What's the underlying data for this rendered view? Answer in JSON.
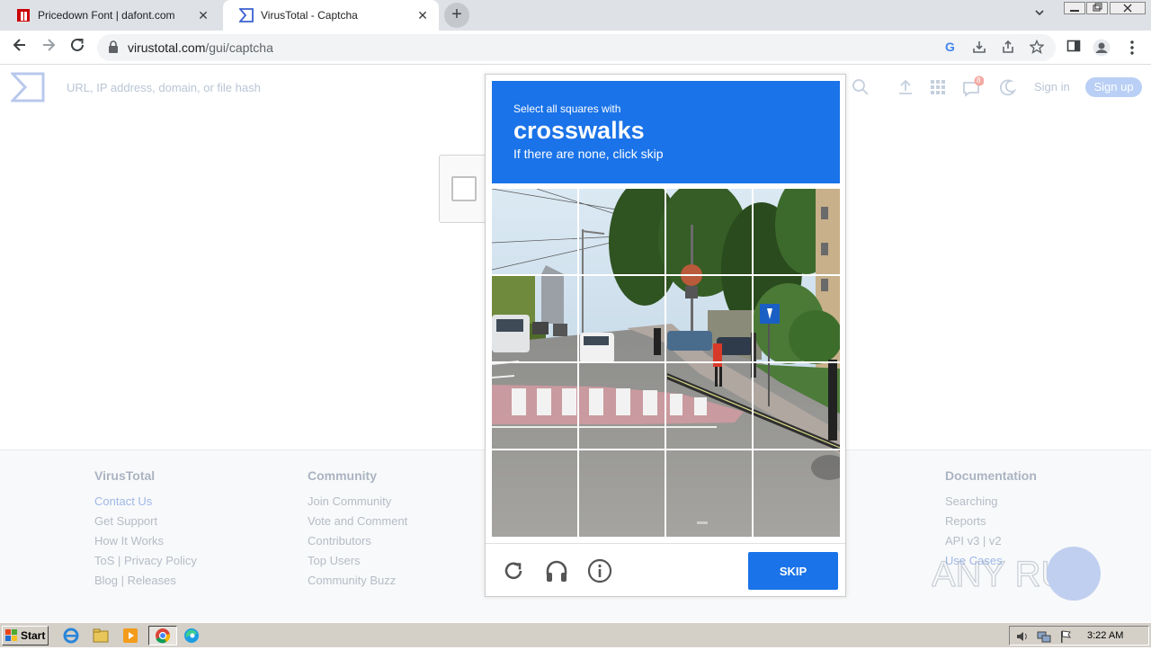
{
  "browser": {
    "tabs": [
      {
        "title": "Pricedown Font | dafont.com",
        "active": false
      },
      {
        "title": "VirusTotal - Captcha",
        "active": true
      }
    ],
    "url_host": "virustotal.com",
    "url_path": "/gui/captcha"
  },
  "vt": {
    "search_placeholder": "URL, IP address, domain, or file hash",
    "notification_count": "8",
    "signin": "Sign in",
    "signup": "Sign up"
  },
  "footer": {
    "columns": [
      {
        "title": "VirusTotal",
        "links": [
          "Contact Us",
          "Get Support",
          "How It Works",
          "ToS | Privacy Policy",
          "Blog | Releases"
        ]
      },
      {
        "title": "Community",
        "links": [
          "Join Community",
          "Vote and Comment",
          "Contributors",
          "Top Users",
          "Community Buzz"
        ]
      },
      {
        "title": "Documentation",
        "links": [
          "Searching",
          "Reports",
          "API v3 | v2",
          "Use Cases"
        ]
      }
    ]
  },
  "captcha": {
    "instruction_line1": "Select all squares with",
    "target": "crosswalks",
    "instruction_line3": "If there are none, click skip",
    "skip_label": "SKIP",
    "grid_size": 4
  },
  "watermark": "ANY RUN",
  "taskbar": {
    "start": "Start",
    "clock": "3:22 AM"
  },
  "colors": {
    "captcha_blue": "#1a73e8",
    "vt_accent": "#b9cff5",
    "taskbar": "#d4d0c8"
  }
}
